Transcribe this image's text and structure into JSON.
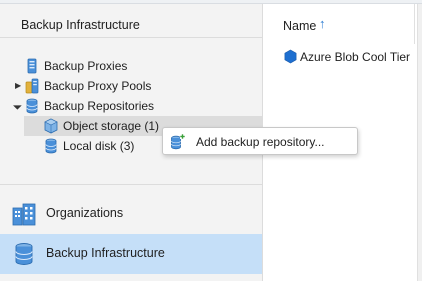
{
  "left_pane": {
    "header": "Backup Infrastructure",
    "tree": [
      {
        "label": "Backup Proxies",
        "icon": "server-icon"
      },
      {
        "label": "Backup Proxy Pools",
        "icon": "proxy-pool-icon"
      },
      {
        "label": "Backup Repositories",
        "icon": "database-icon"
      },
      {
        "label": "Object storage (1)",
        "icon": "object-storage-icon"
      },
      {
        "label": "Local disk (3)",
        "icon": "database-icon"
      }
    ]
  },
  "nav": {
    "organizations": "Organizations",
    "backup_infrastructure": "Backup Infrastructure"
  },
  "right_pane": {
    "column_name": "Name",
    "sort_indicator": "↑",
    "rows": [
      {
        "label": "Azure Blob Cool Tier",
        "icon": "azure-hexagon-icon"
      }
    ]
  },
  "context_menu": {
    "items": [
      {
        "label": "Add backup repository...",
        "icon": "add-repository-icon"
      }
    ]
  },
  "colors": {
    "active_nav": "#c5dff8",
    "selected_row": "#dcdcdc",
    "accent": "#2d7dd2"
  }
}
